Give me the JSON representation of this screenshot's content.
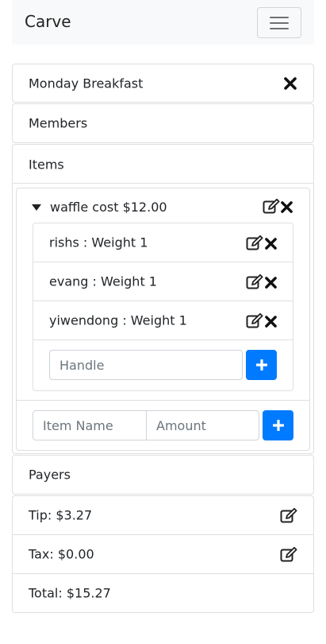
{
  "navbar": {
    "brand": "Carve"
  },
  "cards": {
    "event_title": "Monday Breakfast",
    "members_label": "Members",
    "items_label": "Items",
    "payers_label": "Payers"
  },
  "item": {
    "title": "waffle cost $12.00",
    "members": [
      {
        "label": "rishs : Weight 1"
      },
      {
        "label": "evang : Weight 1"
      },
      {
        "label": "yiwendong : Weight 1"
      }
    ],
    "handle_placeholder": "Handle"
  },
  "new_item": {
    "name_placeholder": "Item Name",
    "amount_placeholder": "Amount"
  },
  "summary": {
    "tip": "Tip: $3.27",
    "tax": "Tax: $0.00",
    "total": "Total: $15.27"
  },
  "colors": {
    "primary": "#007bff",
    "navbar_bg": "#f8f9fa"
  },
  "icons": {
    "close": "close-icon",
    "edit": "edit-icon",
    "caret": "caret-down-icon",
    "plus": "plus-icon",
    "menu": "hamburger-icon"
  }
}
